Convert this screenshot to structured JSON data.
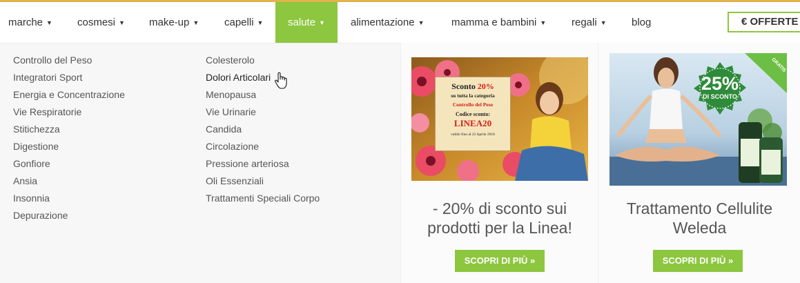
{
  "nav": {
    "items": [
      {
        "label": "marche"
      },
      {
        "label": "cosmesi"
      },
      {
        "label": "make-up"
      },
      {
        "label": "capelli"
      },
      {
        "label": "salute"
      },
      {
        "label": "alimentazione"
      },
      {
        "label": "mamma e bambini"
      },
      {
        "label": "regali"
      },
      {
        "label": "blog"
      }
    ],
    "offerte_label": "€ OFFERTE",
    "caret": "▼"
  },
  "menu": {
    "col1": [
      "Controllo del Peso",
      "Integratori Sport",
      "Energia e Concentrazione",
      "Vie Respiratorie",
      "Stitichezza",
      "Digestione",
      "Gonfiore",
      "Ansia",
      "Insonnia",
      "Depurazione"
    ],
    "col2": [
      "Colesterolo",
      "Dolori Articolari",
      "Menopausa",
      "Vie Urinarie",
      "Candida",
      "Circolazione",
      "Pressione arteriosa",
      "Oli Essenziali",
      "Trattamenti Speciali Corpo"
    ]
  },
  "promo1": {
    "sign_line1": "Sconto",
    "sign_pct": "20%",
    "sign_line2": "su tutta la categoria",
    "sign_line3": "Controllo del Peso",
    "sign_line4": "Codice sconto:",
    "sign_code": "LINEA20",
    "sign_line5": "valido fino al 22 Aprile 2018",
    "title_line1": "- 20% di sconto sui",
    "title_line2": "prodotti per la Linea!",
    "button": "SCOPRI DI PIÙ »"
  },
  "promo2": {
    "badge_pct": "25%",
    "badge_text": "DI SCONTO",
    "ribbon": "GRATIS",
    "title_line1": "Trattamento Cellulite",
    "title_line2": "Weleda",
    "button": "SCOPRI DI PIÙ »"
  },
  "colors": {
    "accent": "#8dc63f",
    "top_line": "#e0b34d",
    "sign_red": "#d6201a"
  }
}
